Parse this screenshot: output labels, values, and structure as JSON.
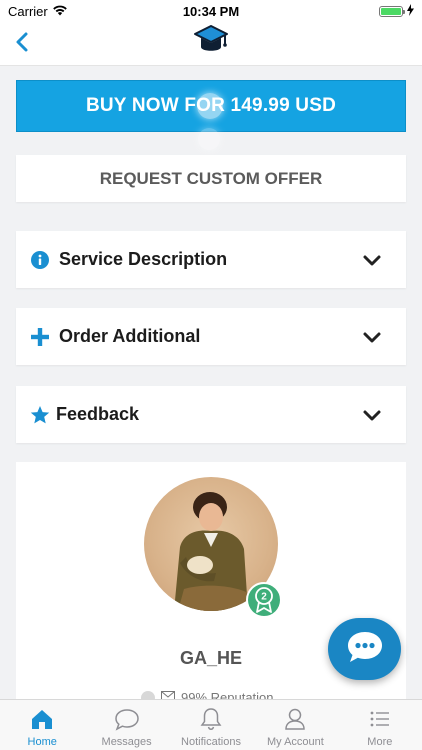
{
  "status_bar": {
    "carrier": "Carrier",
    "time": "10:34 PM",
    "battery_level": 1.0
  },
  "nav": {
    "back_icon": "chevron-left-icon",
    "logo_icon": "graduation-cap-icon"
  },
  "actions": {
    "buy_now_label": "BUY NOW FOR 149.99 USD",
    "custom_offer_label": "REQUEST CUSTOM OFFER"
  },
  "panels": [
    {
      "title": "Service Description",
      "icon": "info-icon"
    },
    {
      "title": "Order Additional",
      "icon": "plus-icon"
    },
    {
      "title": "Feedback",
      "icon": "star-icon"
    }
  ],
  "profile": {
    "username": "GA_HE",
    "badge_level": "2",
    "reputation_text": "99% Reputation"
  },
  "tabs": [
    {
      "label": "Home",
      "icon": "home-icon",
      "active": true
    },
    {
      "label": "Messages",
      "icon": "chat-bubble-icon",
      "active": false
    },
    {
      "label": "Notifications",
      "icon": "bell-icon",
      "active": false
    },
    {
      "label": "My Account",
      "icon": "user-icon",
      "active": false
    },
    {
      "label": "More",
      "icon": "list-icon",
      "active": false
    }
  ],
  "colors": {
    "accent": "#15a3e2",
    "tab_active": "#1a8fd1",
    "badge": "#3fae7a",
    "chat_fab": "#1a86c4"
  }
}
